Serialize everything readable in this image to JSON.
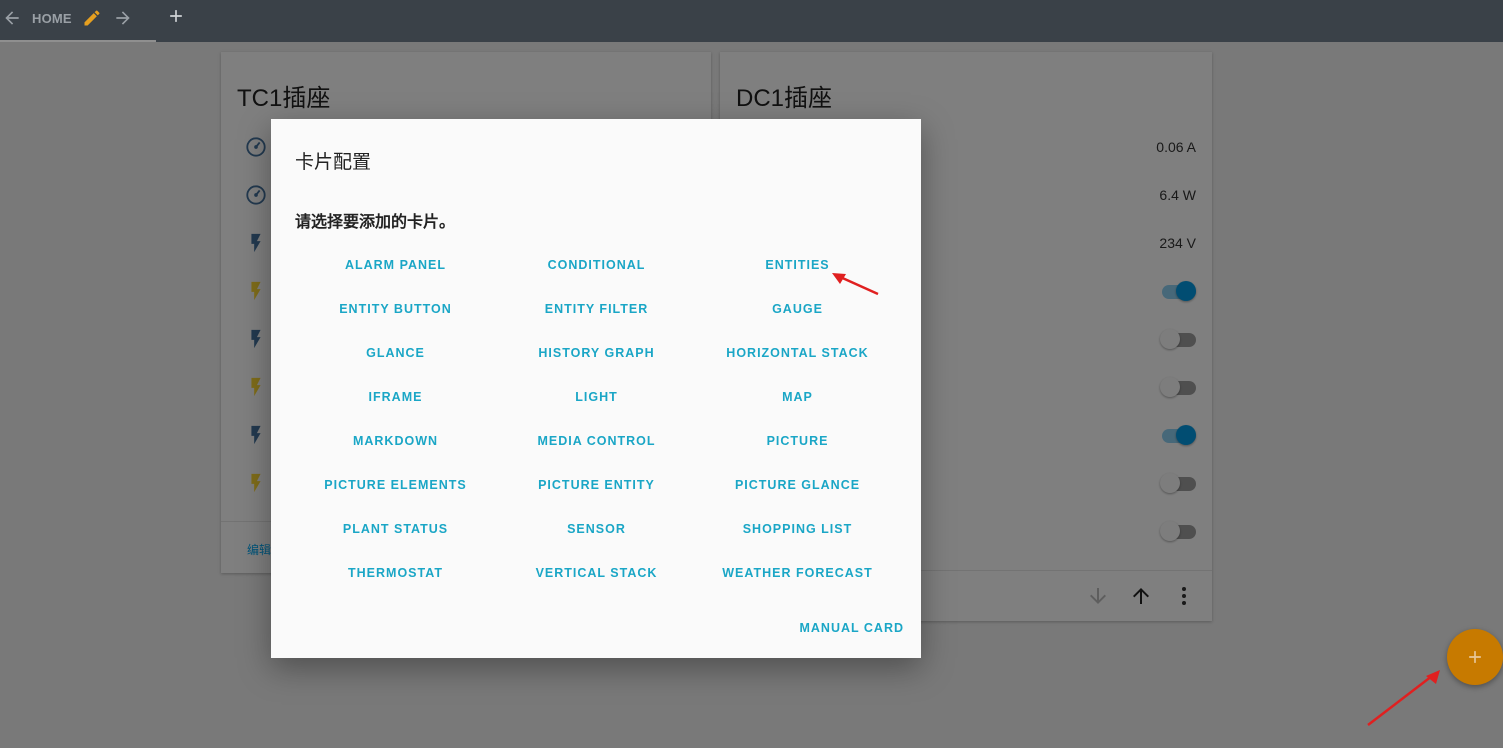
{
  "topbar": {
    "tab_label": "HOME",
    "icons": [
      "arrow-left-icon",
      "pencil-icon",
      "arrow-right-icon",
      "plus-icon"
    ]
  },
  "cards": {
    "left": {
      "title": "TC1插座",
      "edit_label": "编辑"
    },
    "right": {
      "title": "DC1插座",
      "values": [
        "0.06 A",
        "6.4 W",
        "234 V"
      ],
      "toggles": [
        true,
        false,
        false,
        true,
        false,
        false
      ]
    }
  },
  "dialog": {
    "title": "卡片配置",
    "prompt": "请选择要添加的卡片。",
    "card_types": [
      "ALARM PANEL",
      "CONDITIONAL",
      "ENTITIES",
      "ENTITY BUTTON",
      "ENTITY FILTER",
      "GAUGE",
      "GLANCE",
      "HISTORY GRAPH",
      "HORIZONTAL STACK",
      "IFRAME",
      "LIGHT",
      "MAP",
      "MARKDOWN",
      "MEDIA CONTROL",
      "PICTURE",
      "PICTURE ELEMENTS",
      "PICTURE ENTITY",
      "PICTURE GLANCE",
      "PLANT STATUS",
      "SENSOR",
      "SHOPPING LIST",
      "THERMOSTAT",
      "VERTICAL STACK",
      "WEATHER FORECAST"
    ],
    "manual_card": "MANUAL CARD"
  },
  "colors": {
    "accent": "#1aa6c6",
    "toggle_on": "#039be5",
    "fab": "#ff9800",
    "annotation_arrow": "#e02020"
  }
}
